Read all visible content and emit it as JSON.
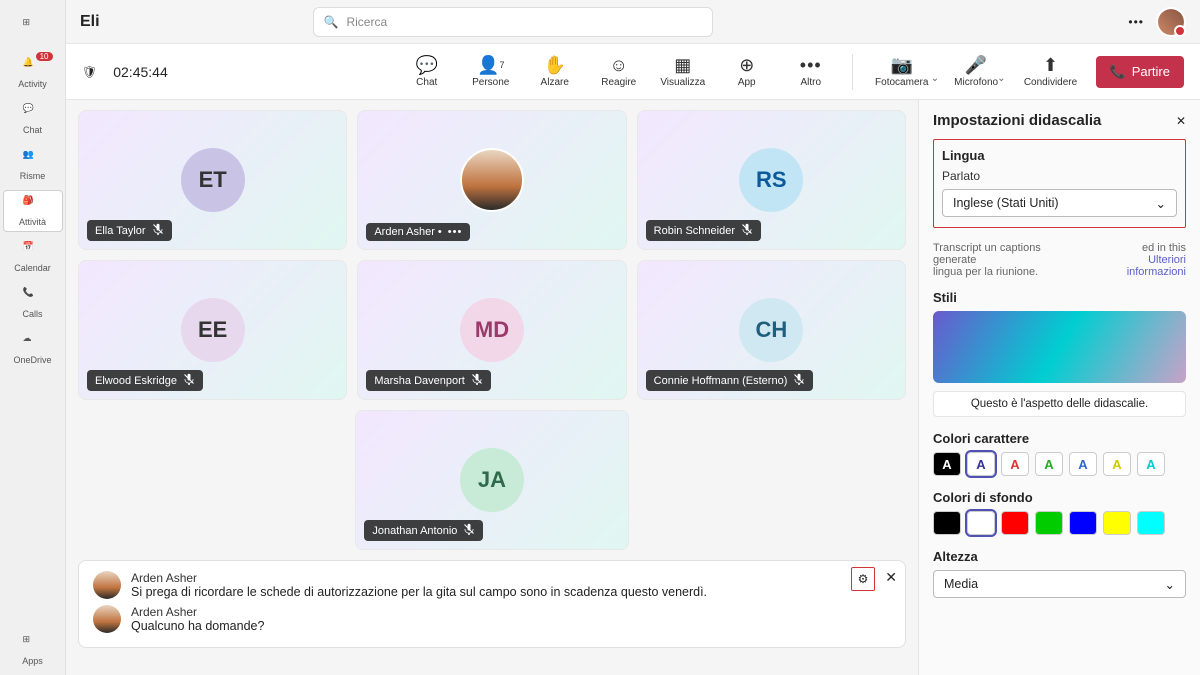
{
  "app_title": "Eli",
  "search_placeholder": "Ricerca",
  "rail": {
    "activity": "Activity",
    "activity_badge": "10",
    "chat": "Chat",
    "teams": "Risme",
    "assignments": "Attività",
    "calendar": "Calendar",
    "calls": "Calls",
    "onedrive": "OneDrive",
    "apps": "Apps"
  },
  "meet": {
    "timer": "02:45:44",
    "chat": "Chat",
    "people": "Persone",
    "people_count": "7",
    "raise": "Alzare",
    "react": "Reagire",
    "view": "Visualizza",
    "app": "App",
    "more": "Altro",
    "camera": "Fotocamera",
    "mic": "Microfono",
    "share": "Condividere",
    "leave": "Partire"
  },
  "participants": [
    {
      "initials": "ET",
      "name": "Ella Taylor",
      "muted": true,
      "photo": false,
      "circle": "c-et"
    },
    {
      "initials": "",
      "name": "Arden Asher •",
      "muted": false,
      "photo": true,
      "circle": ""
    },
    {
      "initials": "RS",
      "name": "Robin Schneider",
      "muted": true,
      "photo": false,
      "circle": "c-rs"
    },
    {
      "initials": "EE",
      "name": "Elwood Eskridge",
      "muted": true,
      "photo": false,
      "circle": "c-ee"
    },
    {
      "initials": "MD",
      "name": "Marsha Davenport",
      "muted": true,
      "photo": false,
      "circle": "c-md"
    },
    {
      "initials": "CH",
      "name": "Connie Hoffmann (Esterno)",
      "muted": true,
      "photo": false,
      "circle": "c-ch"
    },
    {
      "initials": "JA",
      "name": "Jonathan Antonio",
      "muted": true,
      "photo": false,
      "circle": "c-ja"
    }
  ],
  "captions": [
    {
      "name": "Arden Asher",
      "msg": "Si prega di ricordare le schede di autorizzazione per la gita sul campo sono in scadenza questo venerdì."
    },
    {
      "name": "Arden Asher",
      "msg": "Qualcuno ha domande?"
    }
  ],
  "panel": {
    "title": "Impostazioni didascalia",
    "lang_sect": "Lingua",
    "spoken_label": "Parlato",
    "spoken_value": "Inglese (Stati Uniti)",
    "hint_a": "Transcript un captions generate",
    "hint_b": "ed in this",
    "hint_c": "lingua per la riunione.",
    "learn_more": "Ulteriori informazioni",
    "styles": "Stili",
    "preview_text": "Questo è l'aspetto delle didascalie.",
    "font_colors": "Colori carattere",
    "bg_colors": "Colori di sfondo",
    "height": "Altezza",
    "height_value": "Media"
  },
  "font_swatches": [
    {
      "bg": "#000",
      "fg": "#fff",
      "sel": false
    },
    {
      "bg": "#fff",
      "fg": "#333399",
      "sel": true
    },
    {
      "bg": "#fff",
      "fg": "#d33",
      "sel": false
    },
    {
      "bg": "#fff",
      "fg": "#2a2",
      "sel": false
    },
    {
      "bg": "#fff",
      "fg": "#36c",
      "sel": false
    },
    {
      "bg": "#fff",
      "fg": "#cc0",
      "sel": false
    },
    {
      "bg": "#fff",
      "fg": "#0cc",
      "sel": false
    }
  ],
  "bg_swatches": [
    {
      "bg": "#000",
      "sel": false
    },
    {
      "bg": "#fff",
      "sel": true
    },
    {
      "bg": "#f00",
      "sel": false
    },
    {
      "bg": "#0c0",
      "sel": false
    },
    {
      "bg": "#00f",
      "sel": false
    },
    {
      "bg": "#ff0",
      "sel": false
    },
    {
      "bg": "#0ff",
      "sel": false
    }
  ]
}
